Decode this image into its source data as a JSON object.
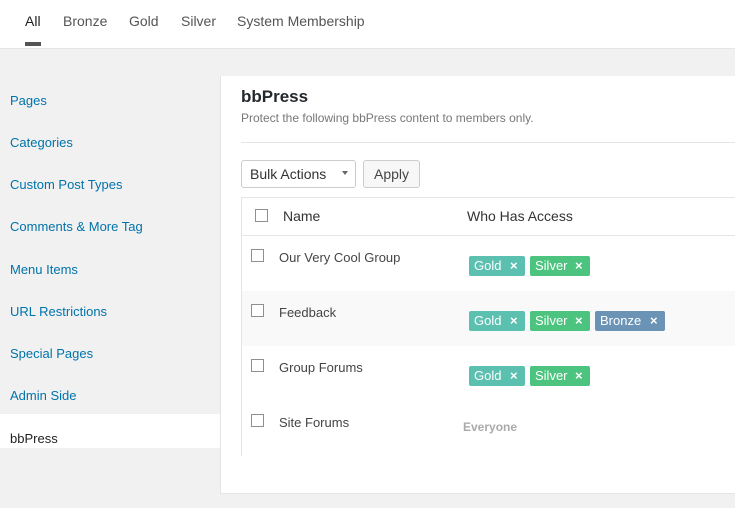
{
  "tabs": [
    "All",
    "Bronze",
    "Gold",
    "Silver",
    "System Membership"
  ],
  "sidebar": {
    "items": [
      "Pages",
      "Categories",
      "Custom Post Types",
      "Comments & More Tag",
      "Menu Items",
      "URL Restrictions",
      "Special Pages",
      "Admin Side",
      "bbPress"
    ],
    "active": "bbPress"
  },
  "panel": {
    "title": "bbPress",
    "description": "Protect the following bbPress content to members only."
  },
  "toolbar": {
    "bulk_actions": "Bulk Actions",
    "apply": "Apply"
  },
  "table": {
    "col_name": "Name",
    "col_access": "Who Has Access",
    "remove_glyph": "×",
    "rows": [
      {
        "name": "Our Very Cool Group",
        "tags": [
          "Gold",
          "Silver"
        ]
      },
      {
        "name": "Feedback",
        "tags": [
          "Gold",
          "Silver",
          "Bronze"
        ]
      },
      {
        "name": "Group Forums",
        "tags": [
          "Gold",
          "Silver"
        ]
      },
      {
        "name": "Site Forums",
        "access_text": "Everyone"
      }
    ]
  },
  "colors": {
    "gold_tag": "#5cc0b1",
    "silver_tag": "#4cc37f",
    "bronze_tag": "#6a93b5",
    "link": "#0073aa"
  }
}
